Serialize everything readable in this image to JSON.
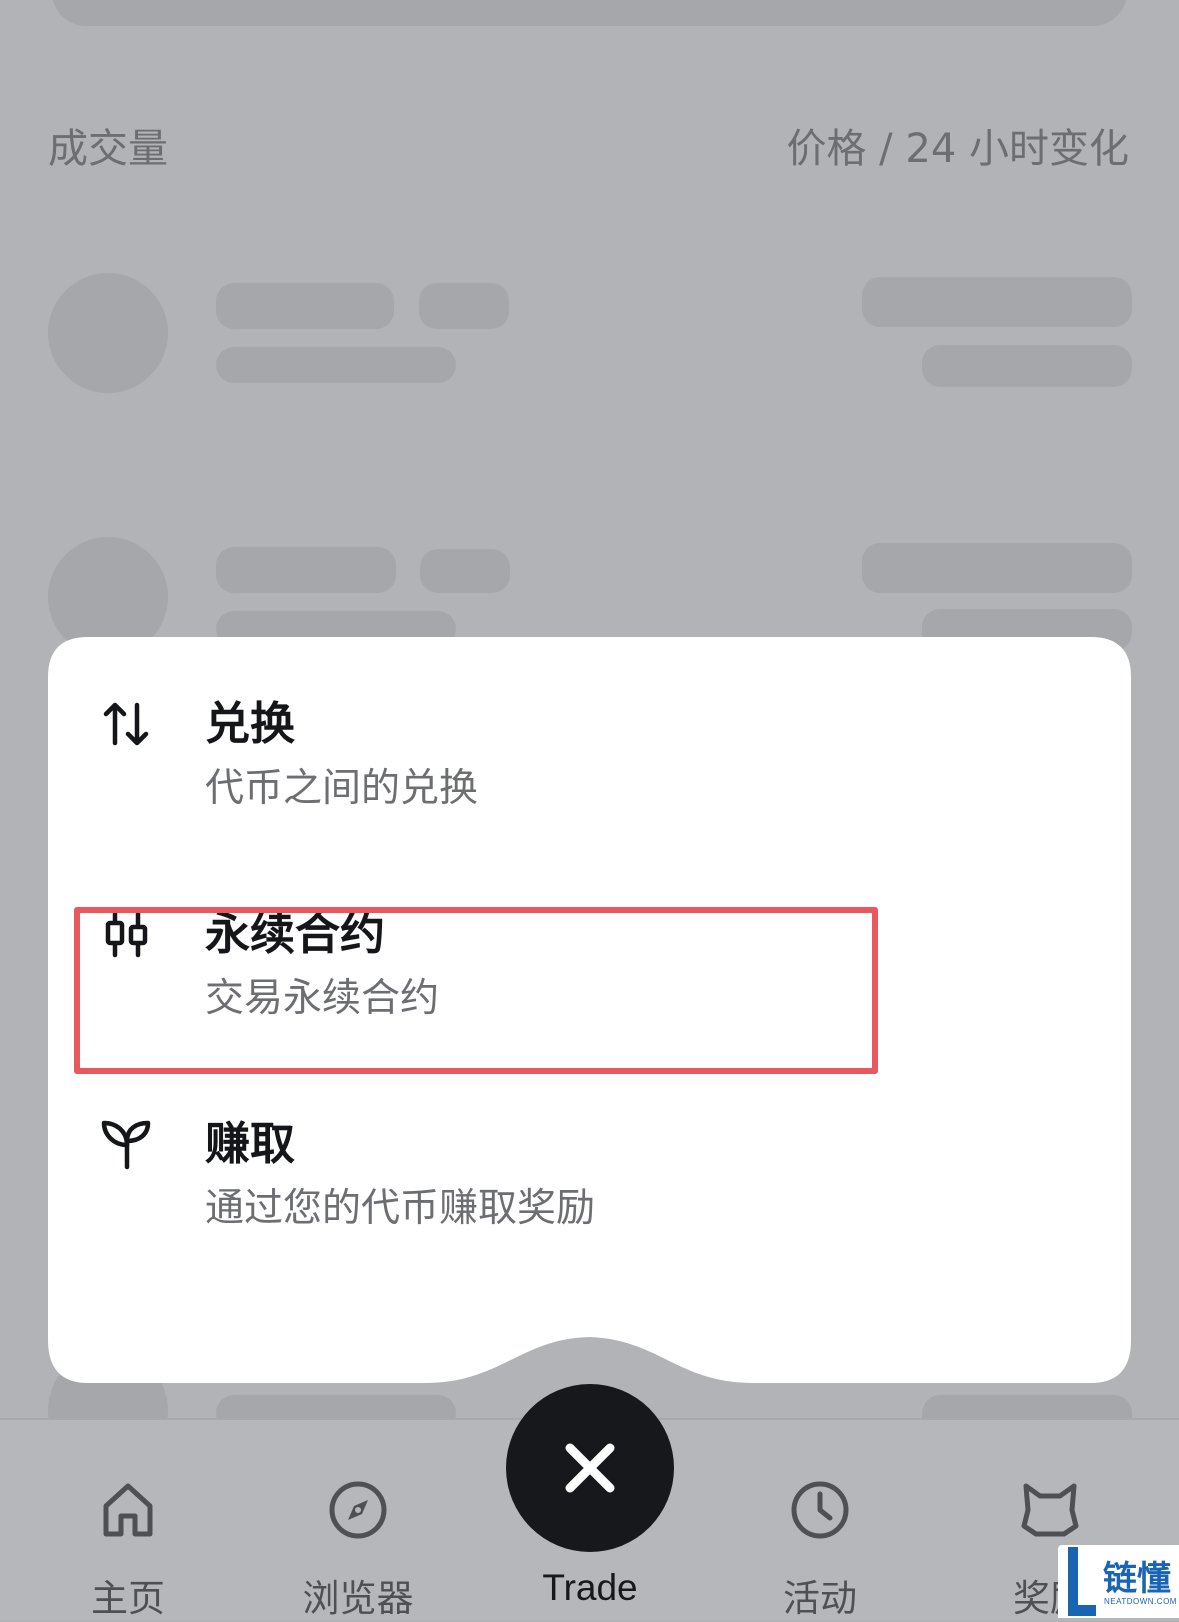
{
  "list_header": {
    "left": "成交量",
    "right": "价格 / 24 小时变化"
  },
  "trade_menu": {
    "items": [
      {
        "icon": "swap-arrows-icon",
        "title": "兑换",
        "subtitle": "代币之间的兑换"
      },
      {
        "icon": "candlestick-icon",
        "title": "永续合约",
        "subtitle": "交易永续合约"
      },
      {
        "icon": "sprout-icon",
        "title": "赚取",
        "subtitle": "通过您的代币赚取奖励"
      }
    ]
  },
  "bottom_nav": {
    "items": [
      {
        "icon": "home-icon",
        "label": "主页"
      },
      {
        "icon": "compass-icon",
        "label": "浏览器"
      },
      {
        "icon": "clock-icon",
        "label": "活动"
      },
      {
        "icon": "fox-icon",
        "label": "奖励"
      }
    ],
    "trade": {
      "icon": "close-icon",
      "label": "Trade"
    }
  },
  "watermark": {
    "text": "链懂",
    "sub": "NEATDOWN.COM"
  },
  "colors": {
    "overlay_bg": "#b2b3b6",
    "skeleton": "#a6a7aa",
    "highlight": "#e9585f",
    "trade_button": "#17181c"
  }
}
